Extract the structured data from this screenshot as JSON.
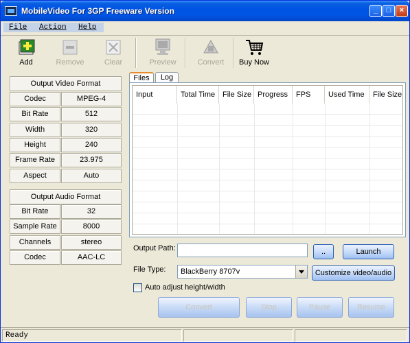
{
  "window": {
    "title": "MobileVideo For 3GP Freeware Version"
  },
  "title_buttons": {
    "minimize": "_",
    "maximize": "□",
    "close": "×"
  },
  "menu": [
    "File",
    "Action",
    "Help"
  ],
  "toolbar": [
    {
      "label": "Add",
      "icon": "add-icon",
      "enabled": true
    },
    {
      "label": "Remove",
      "icon": "remove-icon",
      "enabled": false
    },
    {
      "label": "Clear",
      "icon": "clear-icon",
      "enabled": false
    },
    {
      "label": "Preview",
      "icon": "preview-icon",
      "enabled": false
    },
    {
      "label": "Convert",
      "icon": "convert-icon",
      "enabled": false
    },
    {
      "label": "Buy Now",
      "icon": "cart-icon",
      "enabled": true
    }
  ],
  "video_format": {
    "header": "Output Video Format",
    "rows": [
      {
        "label": "Codec",
        "value": "MPEG-4"
      },
      {
        "label": "Bit Rate",
        "value": "512"
      },
      {
        "label": "Width",
        "value": "320"
      },
      {
        "label": "Height",
        "value": "240"
      },
      {
        "label": "Frame Rate",
        "value": "23.975"
      },
      {
        "label": "Aspect",
        "value": "Auto"
      }
    ]
  },
  "audio_format": {
    "header": "Output Audio Format",
    "rows": [
      {
        "label": "Bit Rate",
        "value": "32"
      },
      {
        "label": "Sample Rate",
        "value": "8000"
      },
      {
        "label": "Channels",
        "value": "stereo"
      },
      {
        "label": "Codec",
        "value": "AAC-LC"
      }
    ]
  },
  "tabs": [
    "Files",
    "Log"
  ],
  "file_list": {
    "columns": [
      "Input",
      "Total Time",
      "File Size",
      "Progress",
      "FPS",
      "Used Time",
      "File Size"
    ],
    "rows": []
  },
  "output": {
    "path_label": "Output Path:",
    "path_value": "",
    "browse_label": "..",
    "launch_label": "Launch",
    "file_type_label": "File Type:",
    "file_type_value": "BlackBerry 8707v",
    "customize_label": "Customize video/audio",
    "auto_adjust_label": "Auto adjust height/width"
  },
  "actions": {
    "convert": "Convert",
    "stop": "Stop",
    "pause": "Pause",
    "resume": "Resume"
  },
  "status": {
    "text": "Ready"
  },
  "colors": {
    "title_bar": "#0054e3",
    "menu_highlight": "#c5d3e8",
    "window_bg": "#ece9d8"
  }
}
